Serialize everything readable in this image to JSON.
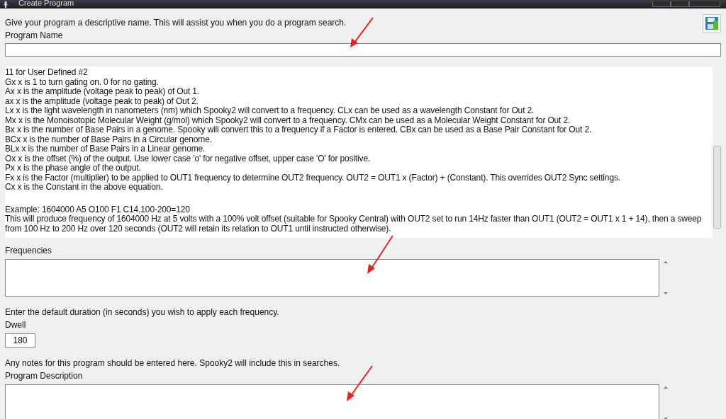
{
  "window": {
    "title": "Create Program"
  },
  "program_name": {
    "hint": "Give your program a descriptive name. This will assist you when you do a program search.",
    "label": "Program Name"
  },
  "help": {
    "paragraphs": [
      {
        "lines": [
          "11 for User Defined #2",
          "Gx  x is 1 to turn gating on. 0 for no gating.",
          "Ax  x is the amplitude (voltage peak to peak) of Out 1.",
          "ax  x is the amplitude (voltage peak to peak) of Out 2.",
          "Lx  x is the light wavelength in nanometers (nm) which Spooky2 will convert to a frequency. CLx can be used as a wavelength Constant for Out 2.",
          "Mx  x is the Monoisotopic Molecular Weight (g/mol) which Spooky2 will convert to a frequency. CMx can be used as a Molecular Weight Constant for Out 2.",
          "Bx  x is the number of Base Pairs in a genome. Spooky will convert this to a frequency if a Factor is entered. CBx can be used as a Base Pair Constant for Out 2.",
          "BCx x is the number of Base Pairs in a Circular genome.",
          "BLx x is the number of Base Pairs in a Linear genome.",
          "Ox  x is the offset (%) of the output. Use lower case 'o' for negative offset, upper case 'O' for positive.",
          "Px  x is the phase angle of the output.",
          "Fx  x is the Factor (multiplier) to be applied to OUT1 frequency to determine OUT2 frequency. OUT2 = OUT1 x (Factor) + (Constant). This overrides OUT2 Sync settings.",
          "Cx  x is the Constant in the above equation."
        ]
      },
      {
        "lines": [
          "Example: 1604000 A5 O100 F1 C14,100-200=120",
          "This will produce frequency of 1604000 Hz at 5 volts with a 100% volt offset (suitable for Spooky Central) with OUT2 set to run 14Hz faster than OUT1 (OUT2 = OUT1 x 1 + 14), then a sweep from 100 Hz to 200 Hz over 120 seconds (OUT2 will retain its relation to OUT1 until instructed otherwise)."
        ]
      }
    ]
  },
  "frequencies": {
    "label": "Frequencies"
  },
  "dwell": {
    "hint": "Enter the default duration (in seconds) you wish to apply each frequency.",
    "label": "Dwell",
    "value": "180"
  },
  "description": {
    "hint": "Any notes for this program should be entered here. Spooky2 will include this in searches.",
    "label": "Program Description"
  }
}
